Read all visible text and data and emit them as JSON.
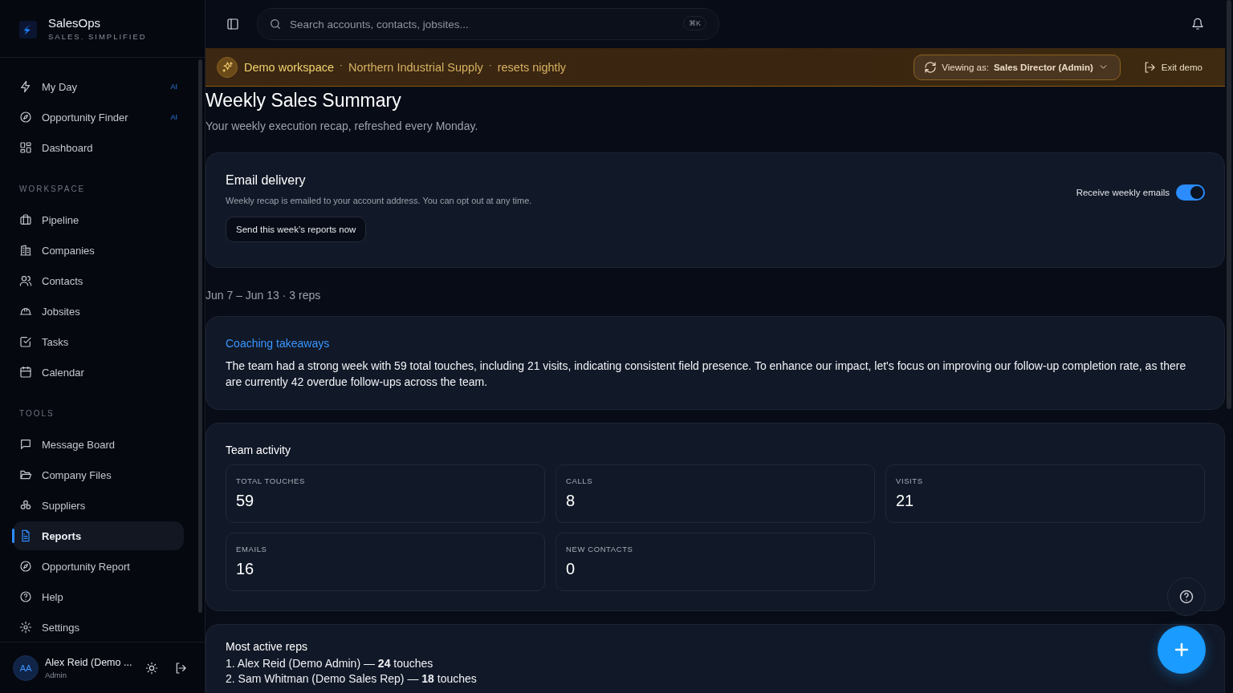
{
  "brand": {
    "name": "SalesOps",
    "tagline": "SALES. SIMPLIFIED"
  },
  "sidebar": {
    "sections": [
      {
        "items": [
          {
            "label": "My Day",
            "badge": "AI",
            "selected": false
          },
          {
            "label": "Opportunity Finder",
            "badge": "AI",
            "selected": false
          },
          {
            "label": "Dashboard",
            "selected": false
          }
        ]
      },
      {
        "heading": "WORKSPACE",
        "items": [
          {
            "label": "Pipeline",
            "selected": false
          },
          {
            "label": "Companies",
            "selected": false
          },
          {
            "label": "Contacts",
            "selected": false
          },
          {
            "label": "Jobsites",
            "selected": false
          },
          {
            "label": "Tasks",
            "selected": false
          },
          {
            "label": "Calendar",
            "selected": false
          }
        ]
      },
      {
        "heading": "TOOLS",
        "items": [
          {
            "label": "Message Board",
            "selected": false
          },
          {
            "label": "Company Files",
            "selected": false
          },
          {
            "label": "Suppliers",
            "selected": false
          },
          {
            "label": "Reports",
            "selected": true
          },
          {
            "label": "Opportunity Report",
            "selected": false
          },
          {
            "label": "Help",
            "selected": false
          },
          {
            "label": "Settings",
            "selected": false
          }
        ]
      }
    ],
    "user": {
      "initials": "AA",
      "name": "Alex Reid (Demo ...",
      "role": "Admin"
    }
  },
  "search": {
    "placeholder": "Search accounts, contacts, jobsites...",
    "shortcut": "⌘K"
  },
  "banner": {
    "title": "Demo workspace",
    "details": [
      {
        "kind": "dot",
        "text": "·"
      },
      {
        "kind": "text",
        "text": "Northern Industrial Supply"
      },
      {
        "kind": "dot",
        "text": "·"
      },
      {
        "kind": "text",
        "text": "resets nightly"
      }
    ],
    "viewing_label": "Viewing as:",
    "viewing_value": "Sales Director (Admin)",
    "exit": "Exit demo"
  },
  "page": {
    "title": "Weekly Sales Summary",
    "subtitle": "Your weekly execution recap, refreshed every Monday."
  },
  "email": {
    "title": "Email delivery",
    "text": "Weekly recap is emailed to your account address. You can opt out at any time.",
    "button": "Send this week’s reports now",
    "toggle_label": "Receive weekly emails",
    "on": true
  },
  "period": "Jun 7 – Jun 13 · 3 reps",
  "coaching": {
    "title": "Coaching takeaways",
    "text": "The team had a strong week with 59 total touches, including 21 visits, indicating consistent field presence. To enhance our impact, let's focus on improving our follow-up completion rate, as there are currently 42 overdue follow-ups across the team."
  },
  "activity": {
    "title": "Team activity",
    "stats": [
      {
        "label": "TOTAL TOUCHES",
        "value": "59"
      },
      {
        "label": "CALLS",
        "value": "8"
      },
      {
        "label": "VISITS",
        "value": "21"
      },
      {
        "label": "EMAILS",
        "value": "16"
      },
      {
        "label": "NEW CONTACTS",
        "value": "0"
      }
    ]
  },
  "reps": {
    "title": "Most active reps",
    "items": [
      "1. Alex Reid (Demo Admin) — **24** touches",
      "2. Sam Whitman (Demo Sales Rep) — **18** touches"
    ]
  }
}
